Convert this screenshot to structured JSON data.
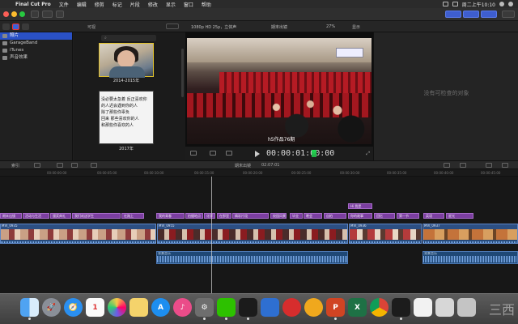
{
  "menubar": {
    "app": "Final Cut Pro",
    "items": [
      "文件",
      "编辑",
      "修剪",
      "标记",
      "片段",
      "修改",
      "显示",
      "窗口",
      "帮助"
    ],
    "clock": "周二上午10:10"
  },
  "sidebar": {
    "items": [
      {
        "label": "照片",
        "selected": true
      },
      {
        "label": "GarageBand",
        "selected": false
      },
      {
        "label": "iTunes",
        "selected": false
      },
      {
        "label": "声音效果",
        "selected": false
      }
    ]
  },
  "browser": {
    "filter_label": "可视",
    "thumbnails": [
      {
        "caption": "2014-2015年",
        "lines": []
      },
      {
        "caption": "2017年",
        "lines": [
          "没必要太急着 反正喜欢你",
          "的人迟会遇到你的人",
          "除了那些你辜负",
          "回来 那些喜欢你的人",
          "和那些你喜欢的人"
        ]
      }
    ]
  },
  "viewer": {
    "format": "1080p HD 25p，立体声",
    "project_name": "期末出镜",
    "zoom": "27%",
    "show_menu": "显示",
    "subtitle": "h5作品76期",
    "timecode": "00:00:01:00:00"
  },
  "inspector": {
    "empty_text": "没有可检查的对象"
  },
  "timeline": {
    "index_label": "索引",
    "project": "期末出镜",
    "duration": "02:07:01",
    "ruler": [
      "00:00:00:00",
      "00:00:05:00",
      "00:00:10:00",
      "00:00:15:00",
      "00:00:20:00",
      "00:00:25:00",
      "00:00:30:00",
      "00:00:35:00",
      "00:00:40:00",
      "00:00:45:00",
      "00:00:50:00"
    ],
    "title_clips": [
      "期末出镜",
      "活动与生活",
      "颁奖典礼",
      "我们欢送学生",
      "在路上",
      "我的青春",
      "拍摄地点",
      "化学",
      "在那里",
      "精彩片段",
      "校园风景",
      "毕业",
      "晚会",
      "自拍",
      "你的故事",
      "回忆",
      "第一节",
      "英语",
      "星光",
      "Hi 我是"
    ],
    "title_top": "Hi 我是",
    "video_clips": [
      {
        "label": "MVI_0935"
      },
      {
        "label": "MVI_0955"
      },
      {
        "label": "MVI_0936"
      },
      {
        "label": "MVI_0937"
      }
    ],
    "audio_clips": [
      {
        "label": "背景音乐"
      },
      {
        "label": "背景音乐"
      }
    ]
  },
  "dock": {
    "apps": [
      "Finder",
      "Launchpad",
      "Safari",
      "Calendar",
      "Photos",
      "Notes",
      "App Store",
      "iTunes",
      "System Preferences",
      "WeChat",
      "QQ",
      "Dictionary",
      "NetEase Music",
      "iQIYI",
      "PowerPoint",
      "Excel",
      "Chrome",
      "Final Cut Pro",
      "Pages",
      "Preview",
      "Trash"
    ],
    "clock_text": "三西"
  }
}
